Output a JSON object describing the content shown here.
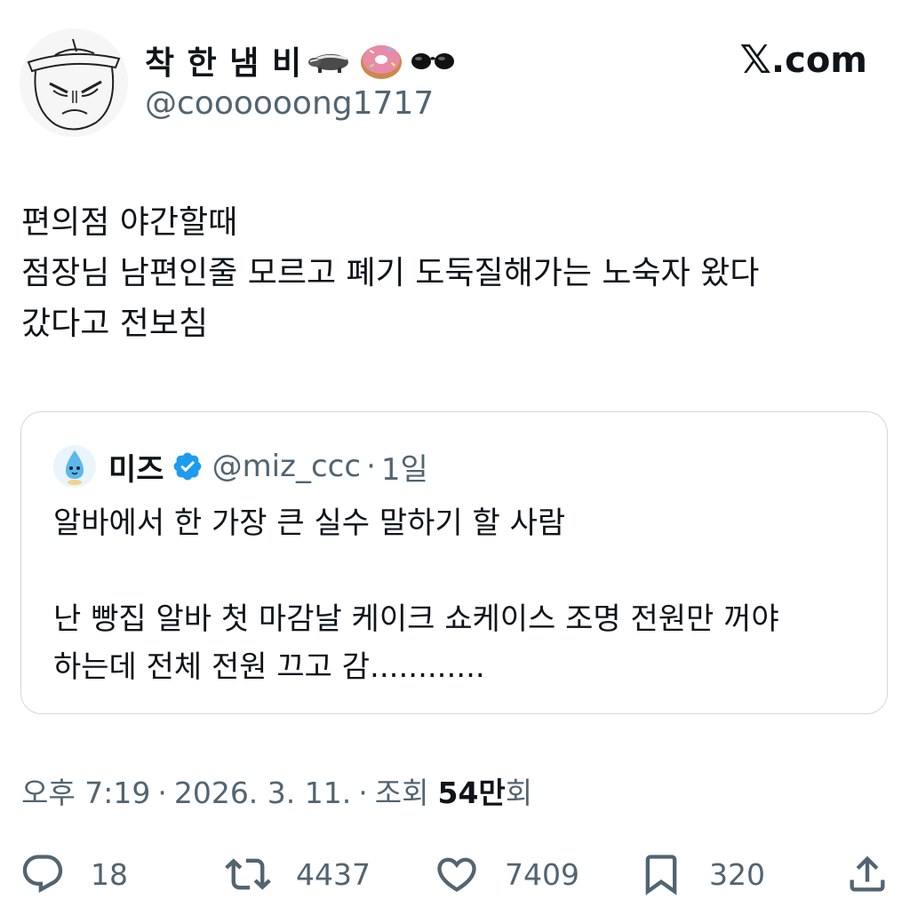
{
  "author": {
    "display_name": "착 한 냄 비",
    "display_name_emojis": [
      "badger-emoji",
      "doughnut-emoji",
      "sunglasses-emoji"
    ],
    "handle": "@coooooong1717"
  },
  "brand": {
    "x_glyph": "𝕏",
    "domain": ".com"
  },
  "tweet": {
    "lines": [
      "편의점 야간할때",
      "점장님 남편인줄 모르고 폐기 도둑질해가는 노숙자 왔다",
      "갔다고 전보침"
    ]
  },
  "quote": {
    "name": "미즈",
    "verified": true,
    "handle": "@miz_ccc",
    "dot": "·",
    "time": "1일",
    "lines": [
      "알바에서 한 가장 큰 실수 말하기 할 사람",
      "",
      "난 빵집 알바 첫 마감날 케이크 쇼케이스 조명 전원만 꺼야",
      "하는데 전체 전원 끄고 감............"
    ]
  },
  "meta": {
    "time": "오후 7:19",
    "sep": "·",
    "date": "2026. 3. 11.",
    "views_label": "조회",
    "views_count": "54만",
    "views_suffix": "회"
  },
  "actions": {
    "replies": "18",
    "reposts": "4437",
    "likes": "7409",
    "bookmarks": "320"
  },
  "colors": {
    "text": "#0f1419",
    "secondary": "#536471",
    "border": "#cfd9de",
    "verified_blue": "#1d9bf0"
  }
}
